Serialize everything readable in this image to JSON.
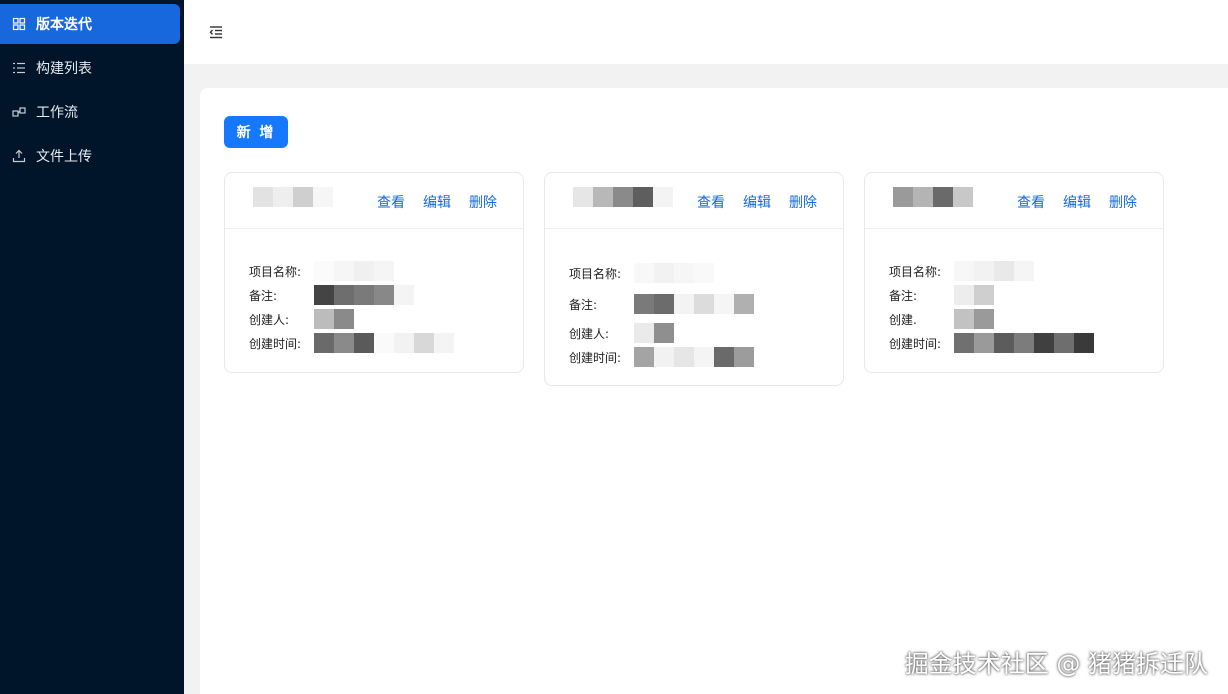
{
  "sidebar": {
    "items": [
      {
        "label": "版本迭代",
        "icon": "grid-icon",
        "active": true
      },
      {
        "label": "构建列表",
        "icon": "list-icon",
        "active": false
      },
      {
        "label": "工作流",
        "icon": "workflow-icon",
        "active": false
      },
      {
        "label": "文件上传",
        "icon": "upload-icon",
        "active": false
      }
    ]
  },
  "header": {
    "toggle_icon": "menu-fold-icon"
  },
  "toolbar": {
    "add_label": "新 增"
  },
  "cards": [
    {
      "actions": {
        "view": "查看",
        "edit": "编辑",
        "delete": "删除"
      },
      "fields": {
        "name_label": "项目名称:",
        "remark_label": "备注:",
        "creator_label": "创建人:",
        "time_label": "创建时间:"
      }
    },
    {
      "actions": {
        "view": "查看",
        "edit": "编辑",
        "delete": "删除"
      },
      "fields": {
        "name_label": "项目名称:",
        "remark_label": "备注:",
        "creator_label": "创建人:",
        "time_label": "创建时间:"
      }
    },
    {
      "actions": {
        "view": "查看",
        "edit": "编辑",
        "delete": "删除"
      },
      "fields": {
        "name_label": "项目名称:",
        "remark_label": "备注:",
        "creator_label": "创建.",
        "time_label": "创建时间:"
      }
    }
  ],
  "watermark": "掘金技术社区 @ 猪猪拆迁队",
  "colors": {
    "sidebar_bg": "#001529",
    "active_bg": "#1668dc",
    "primary": "#1677ff",
    "link": "#1668dc"
  }
}
